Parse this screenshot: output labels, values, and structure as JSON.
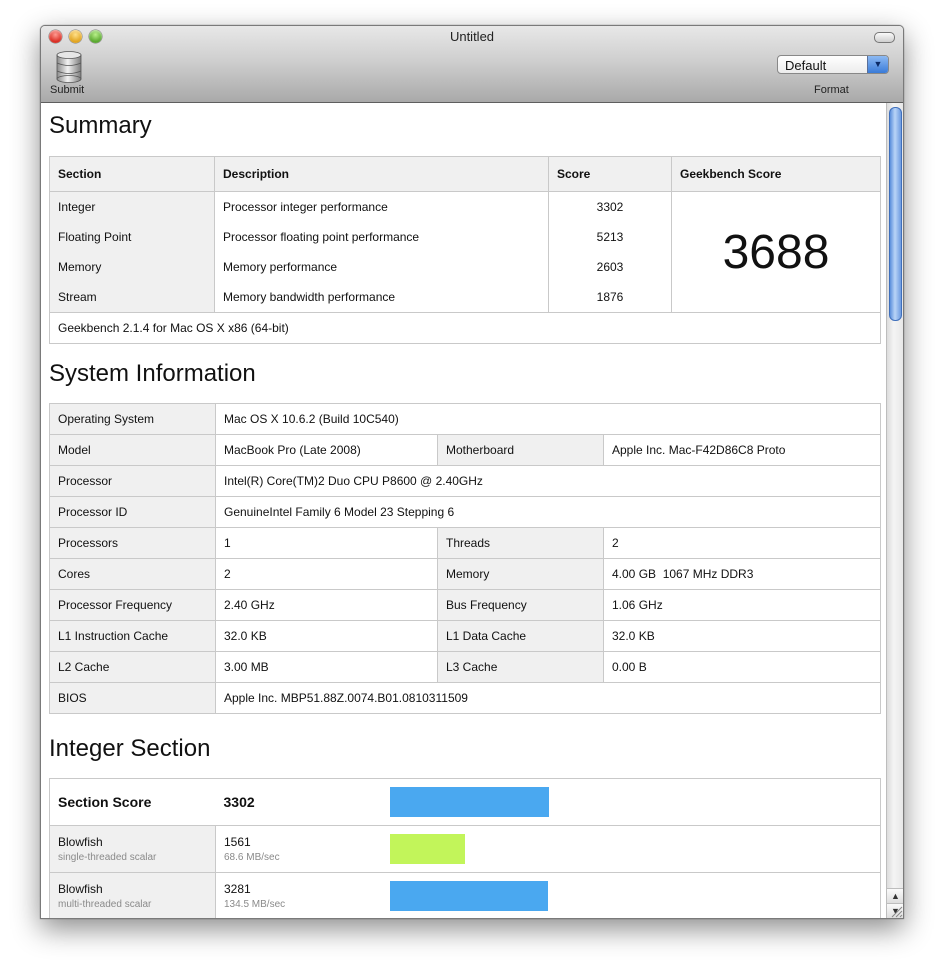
{
  "window": {
    "title": "Untitled"
  },
  "toolbar": {
    "submit_label": "Submit",
    "format_value": "Default",
    "format_label": "Format"
  },
  "summary": {
    "heading": "Summary",
    "headers": [
      "Section",
      "Description",
      "Score",
      "Geekbench Score"
    ],
    "rows": [
      {
        "section": "Integer",
        "description": "Processor integer performance",
        "score": "3302"
      },
      {
        "section": "Floating Point",
        "description": "Processor floating point performance",
        "score": "5213"
      },
      {
        "section": "Memory",
        "description": "Memory performance",
        "score": "2603"
      },
      {
        "section": "Stream",
        "description": "Memory bandwidth performance",
        "score": "1876"
      }
    ],
    "geekbench_score": "3688",
    "version": "Geekbench 2.1.4 for Mac OS X x86 (64-bit)"
  },
  "system": {
    "heading": "System Information",
    "os_label": "Operating System",
    "os_value": "Mac OS X 10.6.2 (Build 10C540)",
    "model_label": "Model",
    "model_value": "MacBook Pro (Late 2008)",
    "motherboard_label": "Motherboard",
    "motherboard_value": "Apple Inc. Mac-F42D86C8 Proto",
    "processor_label": "Processor",
    "processor_value": "Intel(R) Core(TM)2 Duo CPU P8600 @ 2.40GHz",
    "processor_id_label": "Processor ID",
    "processor_id_value": "GenuineIntel Family 6 Model 23 Stepping 6",
    "processors_label": "Processors",
    "processors_value": "1",
    "threads_label": "Threads",
    "threads_value": "2",
    "cores_label": "Cores",
    "cores_value": "2",
    "memory_label": "Memory",
    "memory_value": "4.00 GB  1067 MHz DDR3",
    "freq_label": "Processor Frequency",
    "freq_value": "2.40 GHz",
    "bus_label": "Bus Frequency",
    "bus_value": "1.06 GHz",
    "l1i_label": "L1 Instruction Cache",
    "l1i_value": "32.0 KB",
    "l1d_label": "L1 Data Cache",
    "l1d_value": "32.0 KB",
    "l2_label": "L2 Cache",
    "l2_value": "3.00 MB",
    "l3_label": "L3 Cache",
    "l3_value": "0.00 B",
    "bios_label": "BIOS",
    "bios_value": "Apple Inc. MBP51.88Z.0074.B01.0810311509"
  },
  "integer": {
    "heading": "Integer Section",
    "section_score_label": "Section Score",
    "section_score": "3302",
    "section_score_value": 3302,
    "tests": [
      {
        "name": "Blowfish",
        "subtitle": "single-threaded scalar",
        "score": "1561",
        "score_value": 1561,
        "rate": "68.6 MB/sec",
        "color": "#c2f55a"
      },
      {
        "name": "Blowfish",
        "subtitle": "multi-threaded scalar",
        "score": "3281",
        "score_value": 3281,
        "rate": "134.5 MB/sec",
        "color": "#4aa8f0"
      }
    ],
    "bar_color": "#4aa8f0"
  }
}
